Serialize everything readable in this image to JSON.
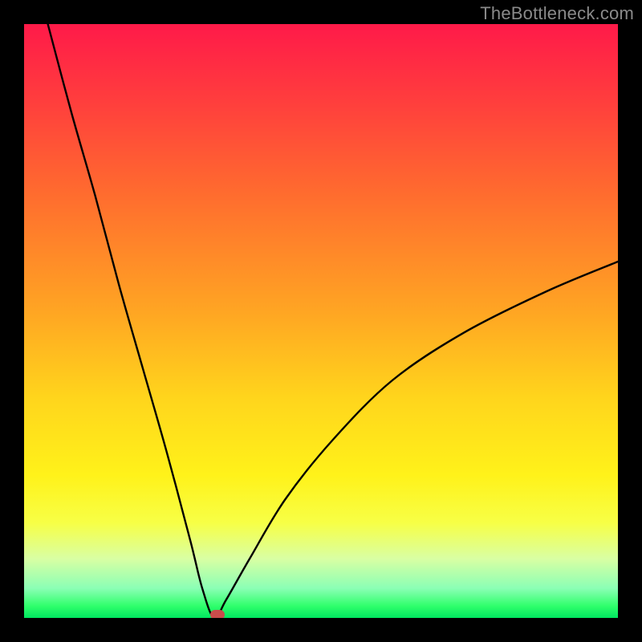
{
  "watermark": {
    "text": "TheBottleneck.com"
  },
  "colors": {
    "frame": "#000000",
    "curve": "#000000",
    "dot": "#c94c4c",
    "gradient_stops": [
      "#ff1a49",
      "#ff3b3e",
      "#ff6a2f",
      "#ffa423",
      "#ffd51c",
      "#fff21a",
      "#f7ff46",
      "#d9ffa3",
      "#8bffb5",
      "#2fff6b",
      "#00e660"
    ]
  },
  "chart_data": {
    "type": "line",
    "title": "",
    "xlabel": "",
    "ylabel": "",
    "xlim": [
      0,
      100
    ],
    "ylim": [
      0,
      100
    ],
    "notes": "Background is a vertical red→green gradient. Curve is a V-shaped absolute-deviation-style function with its minimum at x≈32 touching y≈0, rising steeply to the left (reaching y=100 near x≈4) and more gradually and with diminishing slope to the right (y≈60 at x=100). A small red pill marker sits at the minimum.",
    "series": [
      {
        "name": "curve",
        "x": [
          4,
          8,
          12,
          16,
          20,
          24,
          28,
          30,
          32,
          34,
          38,
          44,
          52,
          62,
          74,
          88,
          100
        ],
        "y": [
          100,
          85,
          71,
          56,
          42,
          28,
          13,
          5,
          0,
          3,
          10,
          20,
          30,
          40,
          48,
          55,
          60
        ]
      }
    ],
    "marker": {
      "x": 32.5,
      "y": 0.5
    }
  }
}
